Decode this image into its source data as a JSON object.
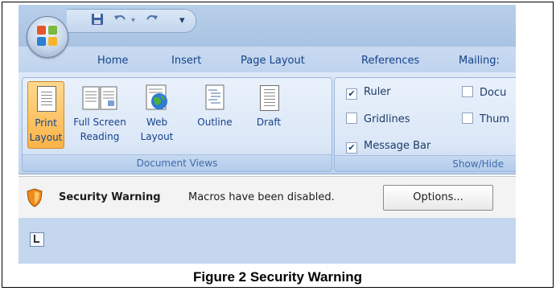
{
  "tabs": [
    "Home",
    "Insert",
    "Page Layout",
    "References",
    "Mailing:"
  ],
  "document_views": {
    "group_label": "Document Views",
    "buttons": [
      {
        "line1": "Print",
        "line2": "Layout",
        "selected": true
      },
      {
        "line1": "Full Screen",
        "line2": "Reading",
        "selected": false
      },
      {
        "line1": "Web",
        "line2": "Layout",
        "selected": false
      },
      {
        "line1": "Outline",
        "line2": "",
        "selected": false
      },
      {
        "line1": "Draft",
        "line2": "",
        "selected": false
      }
    ]
  },
  "show_hide": {
    "group_label": "Show/Hide",
    "items": [
      {
        "label": "Ruler",
        "checked": true
      },
      {
        "label": "Gridlines",
        "checked": false
      },
      {
        "label": "Message Bar",
        "checked": true
      },
      {
        "label": "Docu",
        "checked": false
      },
      {
        "label": "Thum",
        "checked": false
      }
    ]
  },
  "message_bar": {
    "title": "Security Warning",
    "message": "Macros have been disabled.",
    "options_label": "Options..."
  },
  "caption": "Figure 2 Security Warning",
  "colors": {
    "selected_button": "#fbb347",
    "ribbon_text": "#15428b",
    "shield": "#f08a1c"
  },
  "icons": [
    "office-logo-icon",
    "save-icon",
    "undo-icon",
    "redo-icon",
    "customize-qat-icon",
    "shield-icon",
    "ruler-tab-icon"
  ]
}
